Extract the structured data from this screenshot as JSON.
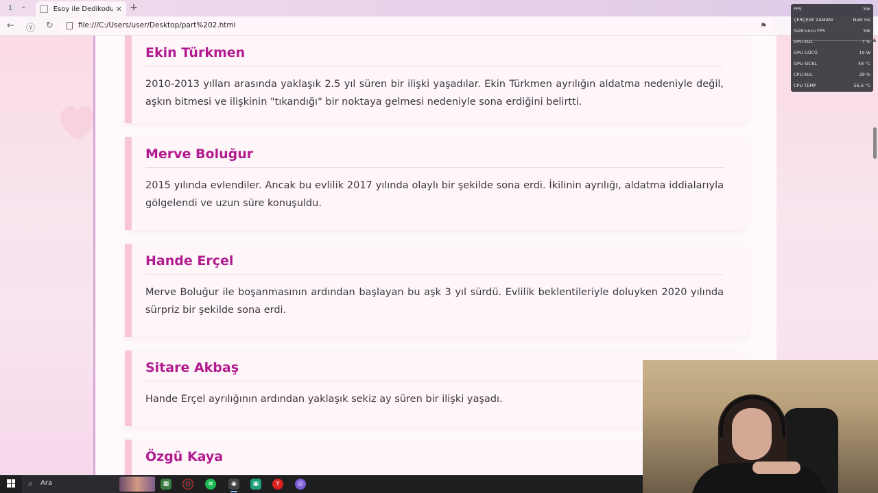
{
  "browser": {
    "tab_count": "1",
    "tab_title": "Esoy ile Dedikodu Köşe",
    "url": "file:///C:/Users/user/Desktop/part%202.html"
  },
  "cards": [
    {
      "name": "Ekin Türkmen",
      "text": "2010-2013 yılları arasında yaklaşık 2.5 yıl süren bir ilişki yaşadılar. Ekin Türkmen ayrılığın aldatma nedeniyle değil, aşkın bitmesi ve ilişkinin \"tıkandığı\" bir noktaya gelmesi nedeniyle sona erdiğini belirtti."
    },
    {
      "name": "Merve Boluğur",
      "text": "2015 yılında evlendiler. Ancak bu evlilik 2017 yılında olaylı bir şekilde sona erdi. İkilinin ayrılığı, aldatma iddialarıyla gölgelendi ve uzun süre konuşuldu."
    },
    {
      "name": "Hande Erçel",
      "text": "Merve Boluğur ile boşanmasının ardından başlayan bu aşk 3 yıl sürdü. Evlilik beklentileriyle doluyken 2020 yılında sürpriz bir şekilde sona erdi."
    },
    {
      "name": "Sitare Akbaş",
      "text": "Hande Erçel ayrılığının ardından yaklaşık sekiz ay süren bir ilişki yaşadı."
    },
    {
      "name": "Özgü Kaya",
      "text": ""
    }
  ],
  "perf_overlay": [
    {
      "label": "FPS",
      "value": "Yok"
    },
    {
      "label": "ÇERÇEVE ZAMANI",
      "value": "NaN ms"
    },
    {
      "label": "%99'uncu FPS",
      "value": "Yok"
    },
    {
      "label": "GPU KUL",
      "value": "7 %"
    },
    {
      "label": "GPU GÜCÜ",
      "value": "19 W"
    },
    {
      "label": "GPU SICKL",
      "value": "48 °C"
    },
    {
      "label": "CPU KUL",
      "value": "29 %"
    },
    {
      "label": "CPU TEMP",
      "value": "56.6 °C"
    }
  ],
  "taskbar": {
    "search_label": "Ara"
  },
  "colors": {
    "heading": "#b21a8f",
    "card_bar": "#f6c6d8",
    "text": "#3a3640"
  }
}
